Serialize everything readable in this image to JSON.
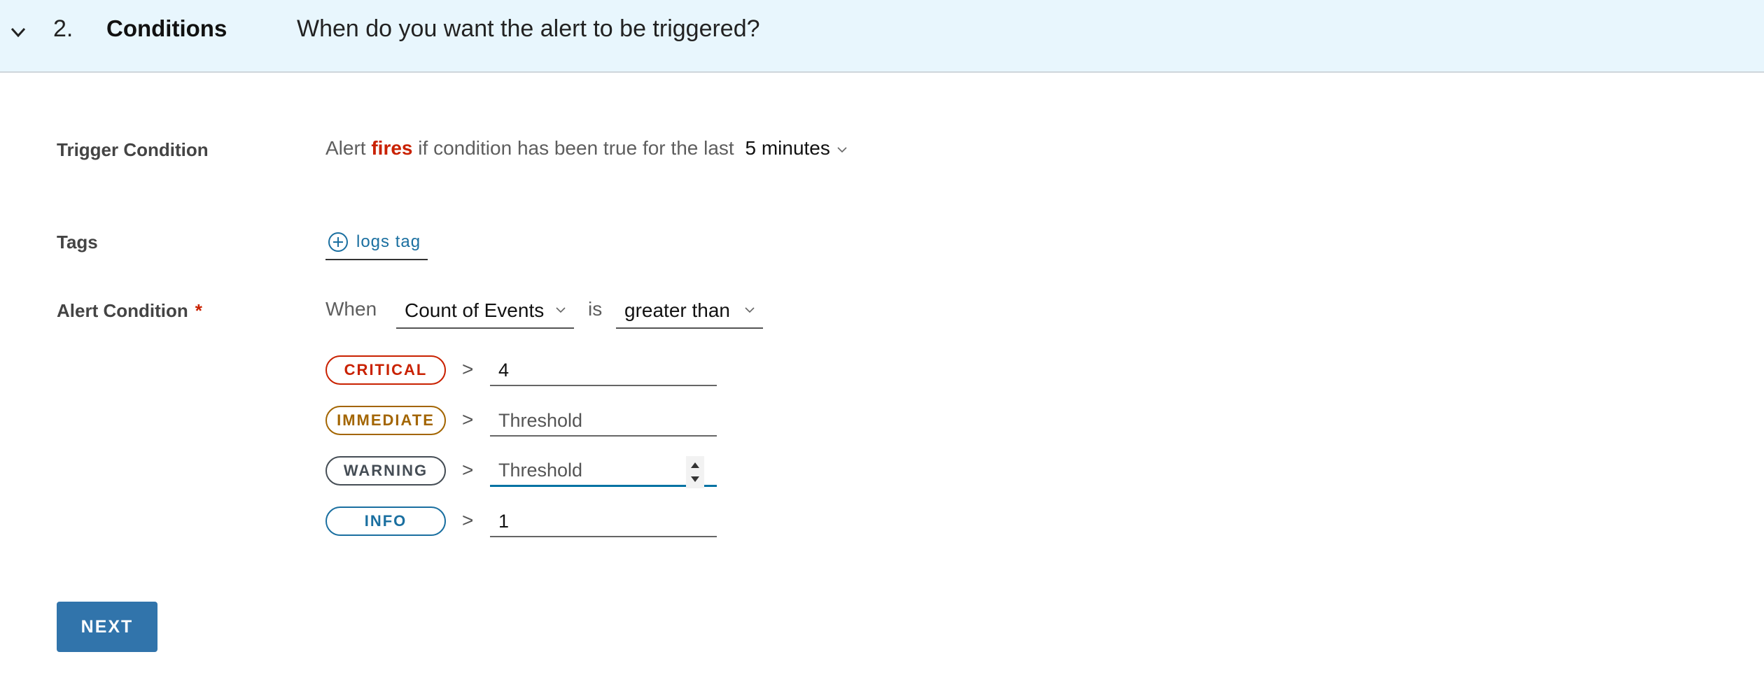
{
  "header": {
    "step_number": "2.",
    "step_title": "Conditions",
    "step_question": "When do you want the alert to be triggered?"
  },
  "trigger": {
    "label": "Trigger Condition",
    "text_prefix": "Alert",
    "text_fires": "fires",
    "text_suffix": "if condition has been true for the last",
    "duration": "5 minutes"
  },
  "tags": {
    "label": "Tags",
    "add_label": "logs tag"
  },
  "alert_condition": {
    "label": "Alert Condition",
    "required_mark": "*",
    "when": "When",
    "metric": "Count of Events",
    "is": "is",
    "operator": "greater than",
    "comparator": ">",
    "thresholds": [
      {
        "severity": "CRITICAL",
        "value": "4",
        "placeholder": "Threshold",
        "color": "#c92100"
      },
      {
        "severity": "IMMEDIATE",
        "value": "",
        "placeholder": "Threshold",
        "color": "#a36500"
      },
      {
        "severity": "WARNING",
        "value": "",
        "placeholder": "Threshold",
        "color": "#454d55"
      },
      {
        "severity": "INFO",
        "value": "1",
        "placeholder": "Threshold",
        "color": "#1a6fa0"
      }
    ]
  },
  "actions": {
    "next_label": "NEXT"
  },
  "colors": {
    "header_bg": "#e8f6fd",
    "accent": "#3174ab",
    "danger": "#c92100"
  }
}
